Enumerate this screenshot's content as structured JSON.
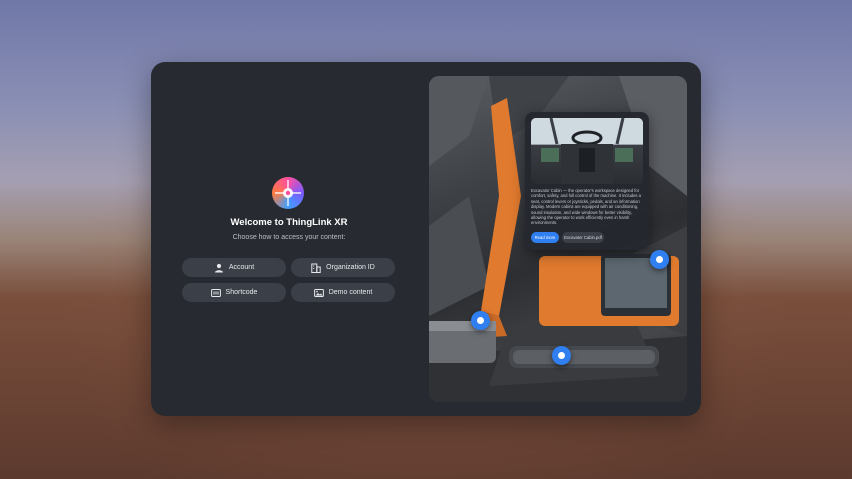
{
  "welcome": {
    "title": "Welcome to ThingLink XR",
    "subtitle": "Choose how to access your content:"
  },
  "options": {
    "account": "Account",
    "organization_id": "Organization ID",
    "shortcode": "Shortcode",
    "demo_content": "Demo content"
  },
  "info_card": {
    "description": "Excavator Cabin — the operator's workspace designed for comfort, safety, and full control of the machine. It includes a seat, control levers or joysticks, pedals, and an information display. Modern cabins are equipped with air conditioning, sound insulation, and wide windows for better visibility, allowing the operator to work efficiently even in harsh environments.",
    "read_more": "Read more",
    "attachment": "Excavator Cabin.pdf"
  },
  "colors": {
    "accent": "#2f7ff0",
    "panel": "#272b31",
    "button": "#3b4048",
    "excavator": "#e07a2e"
  }
}
